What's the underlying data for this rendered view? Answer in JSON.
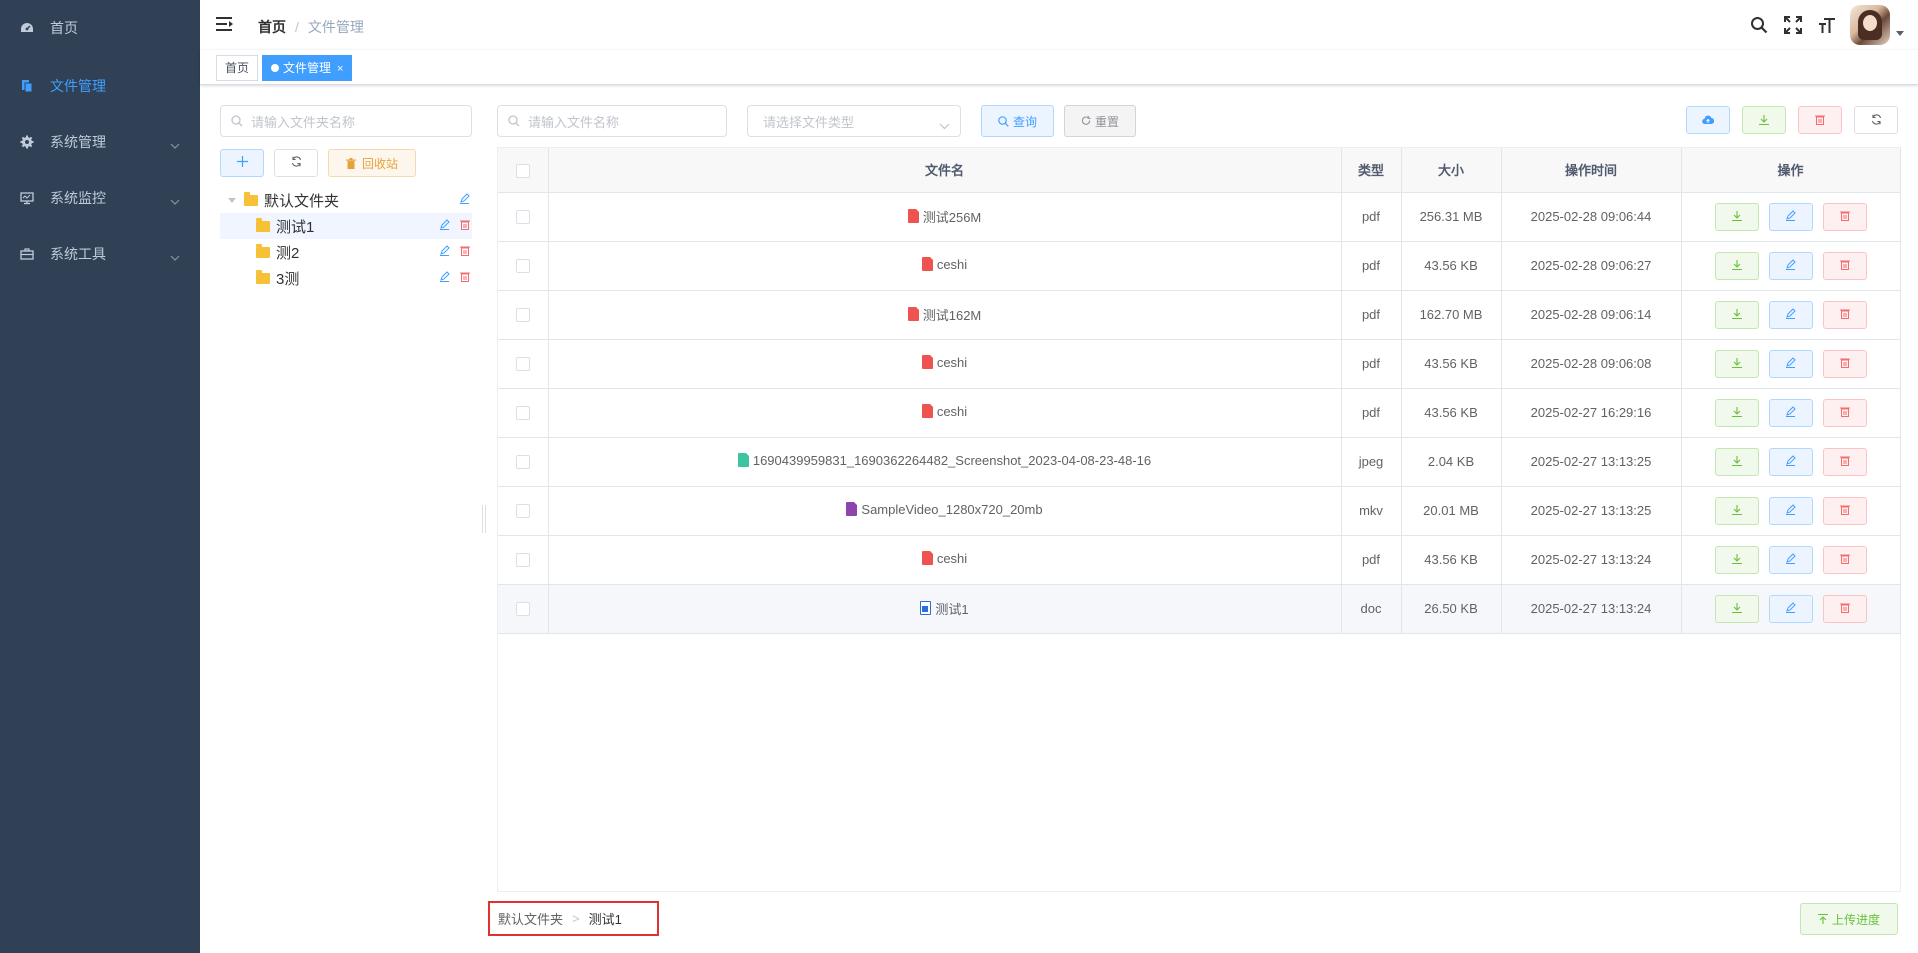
{
  "sidebar": {
    "items": [
      {
        "label": "首页",
        "icon": "dashboard-icon",
        "active": false,
        "has_children": false
      },
      {
        "label": "文件管理",
        "icon": "file-icon",
        "active": true,
        "has_children": false
      },
      {
        "label": "系统管理",
        "icon": "gear-icon",
        "active": false,
        "has_children": true
      },
      {
        "label": "系统监控",
        "icon": "monitor-icon",
        "active": false,
        "has_children": true
      },
      {
        "label": "系统工具",
        "icon": "toolbox-icon",
        "active": false,
        "has_children": true
      }
    ]
  },
  "navbar": {
    "breadcrumb": {
      "home": "首页",
      "separator": "/",
      "current": "文件管理"
    }
  },
  "tags": [
    {
      "label": "首页",
      "active": false
    },
    {
      "label": "文件管理",
      "active": true,
      "close": "×"
    }
  ],
  "folder_panel": {
    "search_placeholder": "请输入文件夹名称",
    "recycle_label": "回收站",
    "tree": [
      {
        "label": "默认文件夹",
        "level": 0,
        "selected": false
      },
      {
        "label": "测试1",
        "level": 1,
        "selected": true
      },
      {
        "label": "测2",
        "level": 1,
        "selected": false
      },
      {
        "label": "3测",
        "level": 1,
        "selected": false
      }
    ]
  },
  "search": {
    "name_placeholder": "请输入文件名称",
    "type_placeholder": "请选择文件类型",
    "query_label": "查询",
    "reset_label": "重置"
  },
  "table": {
    "headers": {
      "name": "文件名",
      "type": "类型",
      "size": "大小",
      "time": "操作时间",
      "ops": "操作"
    },
    "rows": [
      {
        "name": "测试256M",
        "type": "pdf",
        "size": "256.31 MB",
        "time": "2025-02-28 09:06:44"
      },
      {
        "name": "ceshi",
        "type": "pdf",
        "size": "43.56 KB",
        "time": "2025-02-28 09:06:27"
      },
      {
        "name": "测试162M",
        "type": "pdf",
        "size": "162.70 MB",
        "time": "2025-02-28 09:06:14"
      },
      {
        "name": "ceshi",
        "type": "pdf",
        "size": "43.56 KB",
        "time": "2025-02-28 09:06:08"
      },
      {
        "name": "ceshi",
        "type": "pdf",
        "size": "43.56 KB",
        "time": "2025-02-27 16:29:16"
      },
      {
        "name": "1690439959831_1690362264482_Screenshot_2023-04-08-23-48-16",
        "type": "jpeg",
        "size": "2.04 KB",
        "time": "2025-02-27 13:13:25"
      },
      {
        "name": "SampleVideo_1280x720_20mb",
        "type": "mkv",
        "size": "20.01 MB",
        "time": "2025-02-27 13:13:25"
      },
      {
        "name": "ceshi",
        "type": "pdf",
        "size": "43.56 KB",
        "time": "2025-02-27 13:13:24"
      },
      {
        "name": "测试1",
        "type": "doc",
        "size": "26.50 KB",
        "time": "2025-02-27 13:13:24"
      }
    ]
  },
  "path": {
    "root": "默认文件夹",
    "separator": ">",
    "current": "测试1"
  },
  "upload_progress_label": "上传进度",
  "colors": {
    "sidebar_bg": "#304156",
    "primary": "#409eff",
    "success": "#67c23a",
    "danger": "#f56c6c",
    "warning": "#e6a23c"
  }
}
